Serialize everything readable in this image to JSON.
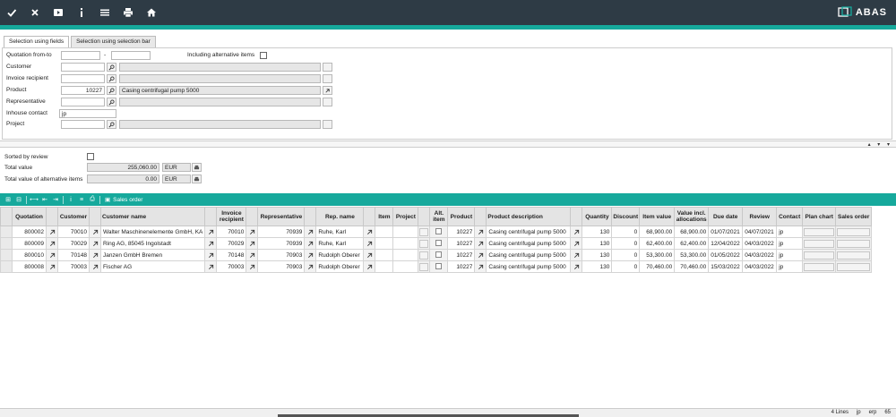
{
  "toolbar": {
    "icons": [
      "check-icon",
      "close-icon",
      "play-icon",
      "info-icon",
      "menu-icon",
      "print-icon",
      "home-icon"
    ],
    "logo_text": "ABAS"
  },
  "tabs": [
    "Selection using fields",
    "Selection using selection bar"
  ],
  "form": {
    "quotation_label": "Quotation from-to",
    "quotation_from": "",
    "dash": "-",
    "quotation_to": "",
    "include_alt_label": "Including alternative items",
    "customer_label": "Customer",
    "customer_value": "",
    "customer_desc": "",
    "invoice_label": "Invoice recipient",
    "invoice_value": "",
    "invoice_desc": "",
    "product_label": "Product",
    "product_value": "10227",
    "product_desc": "Casing centrifugal pump 5000",
    "rep_label": "Representative",
    "rep_value": "",
    "rep_desc": "",
    "inhouse_label": "Inhouse contact",
    "inhouse_value": "jp",
    "project_label": "Project",
    "project_value": "",
    "project_desc": ""
  },
  "summary": {
    "sorted_label": "Sorted by review",
    "total_label": "Total value",
    "total_value": "255,060.00",
    "total_currency": "EUR",
    "alt_label": "Total value of alternative items",
    "alt_value": "0.00",
    "alt_currency": "EUR"
  },
  "table_toolbar": {
    "sales_order_label": "Sales order"
  },
  "table": {
    "headers": [
      "Quotation",
      "Customer",
      "Customer name",
      "Invoice recipient",
      "Representative",
      "Rep. name",
      "Item",
      "Project",
      "Alt. item",
      "Product",
      "Product description",
      "Quantity",
      "Discount",
      "Item value",
      "Value incl. allocations",
      "Due date",
      "Review",
      "Contact",
      "Plan chart",
      "Sales order"
    ],
    "rows": [
      {
        "quotation": "800002",
        "customer": "70010",
        "customer_name": "Walter Maschinenelemente GmbH, KA",
        "invoice": "70010",
        "rep": "70939",
        "rep_name": "Ruhe, Karl",
        "item": "",
        "project": "",
        "product": "10227",
        "product_desc": "Casing centrifugal pump 5000",
        "quantity": "130",
        "discount": "0",
        "item_value": "68,900.00",
        "value_alloc": "68,900.00",
        "due_date": "01/07/2021",
        "review": "04/07/2021",
        "contact": "jp"
      },
      {
        "quotation": "800009",
        "customer": "70029",
        "customer_name": "Ring AG, 85045 Ingolstadt",
        "invoice": "70029",
        "rep": "70939",
        "rep_name": "Ruhe, Karl",
        "item": "",
        "project": "",
        "product": "10227",
        "product_desc": "Casing centrifugal pump 5000",
        "quantity": "130",
        "discount": "0",
        "item_value": "62,400.00",
        "value_alloc": "62,400.00",
        "due_date": "12/04/2022",
        "review": "04/03/2022",
        "contact": "jp"
      },
      {
        "quotation": "800010",
        "customer": "70148",
        "customer_name": "Janzen GmbH Bremen",
        "invoice": "70148",
        "rep": "70903",
        "rep_name": "Rudolph Oberer",
        "item": "",
        "project": "",
        "product": "10227",
        "product_desc": "Casing centrifugal pump 5000",
        "quantity": "130",
        "discount": "0",
        "item_value": "53,300.00",
        "value_alloc": "53,300.00",
        "due_date": "01/05/2022",
        "review": "04/03/2022",
        "contact": "jp"
      },
      {
        "quotation": "800008",
        "customer": "70003",
        "customer_name": "Fischer AG",
        "invoice": "70003",
        "rep": "70903",
        "rep_name": "Rudolph Oberer",
        "item": "",
        "project": "",
        "product": "10227",
        "product_desc": "Casing centrifugal pump 5000",
        "quantity": "130",
        "discount": "0",
        "item_value": "70,460.00",
        "value_alloc": "70,460.00",
        "due_date": "15/03/2022",
        "review": "04/03/2022",
        "contact": "jp"
      }
    ]
  },
  "status": {
    "lines": "4 Lines",
    "user": "jp",
    "mode": "erp",
    "number": "65"
  }
}
